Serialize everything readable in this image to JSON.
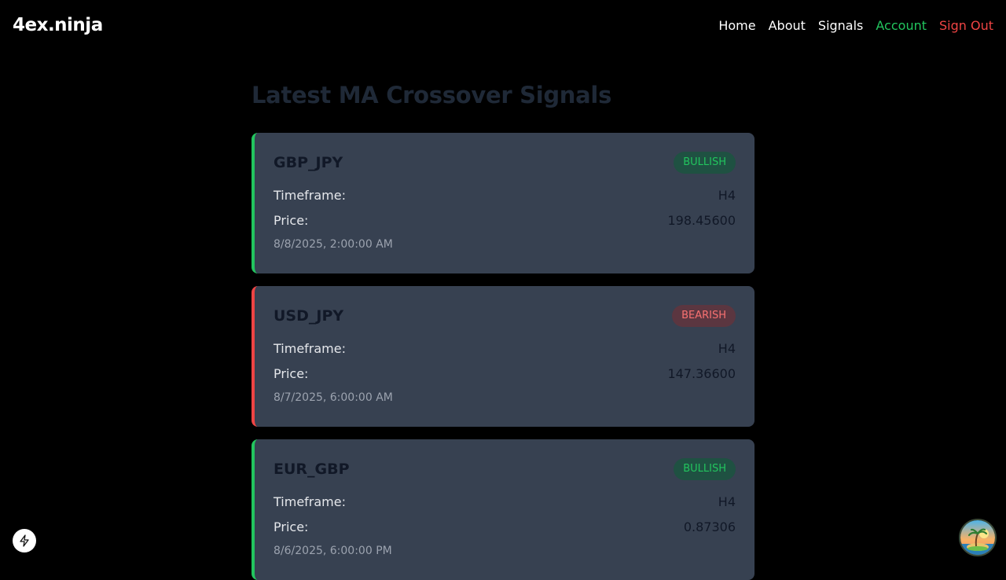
{
  "nav": {
    "brand": "4ex.ninja",
    "links": [
      {
        "label": "Home"
      },
      {
        "label": "About"
      },
      {
        "label": "Signals"
      },
      {
        "label": "Account"
      },
      {
        "label": "Sign Out"
      }
    ]
  },
  "main": {
    "title": "Latest MA Crossover Signals",
    "signals": [
      {
        "pair": "GBP_JPY",
        "direction": "BULLISH",
        "timeframe_label": "Timeframe:",
        "timeframe": "H4",
        "price_label": "Price:",
        "price": "198.45600",
        "timestamp": "8/8/2025, 2:00:00 AM"
      },
      {
        "pair": "USD_JPY",
        "direction": "BEARISH",
        "timeframe_label": "Timeframe:",
        "timeframe": "H4",
        "price_label": "Price:",
        "price": "147.36600",
        "timestamp": "8/7/2025, 6:00:00 AM"
      },
      {
        "pair": "EUR_GBP",
        "direction": "BULLISH",
        "timeframe_label": "Timeframe:",
        "timeframe": "H4",
        "price_label": "Price:",
        "price": "0.87306",
        "timestamp": "8/6/2025, 6:00:00 PM"
      }
    ]
  },
  "colors": {
    "background": "#000000",
    "card": "#374151",
    "bullish": "#22c55e",
    "bearish": "#ef4444"
  },
  "icons": {
    "dev_indicator": "lightning-icon",
    "avatar": "palm-island-avatar"
  }
}
